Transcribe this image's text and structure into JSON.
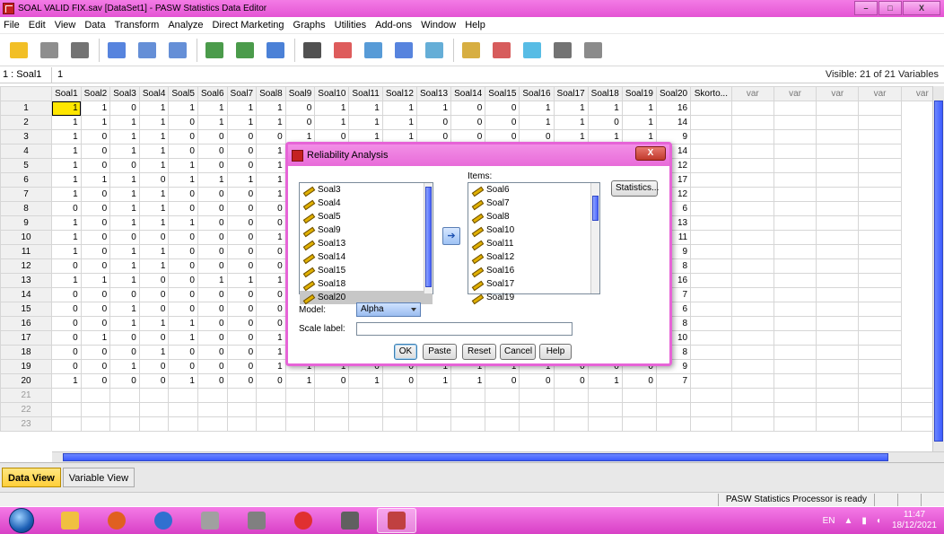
{
  "window": {
    "title": "SOAL VALID FIX.sav [DataSet1] - PASW Statistics Data Editor",
    "min": "–",
    "max": "□",
    "close": "X"
  },
  "menu": [
    "File",
    "Edit",
    "View",
    "Data",
    "Transform",
    "Analyze",
    "Direct Marketing",
    "Graphs",
    "Utilities",
    "Add-ons",
    "Window",
    "Help"
  ],
  "toolbar_icons": [
    "open-icon",
    "save-icon",
    "print-icon",
    "dialog-recall-icon",
    "undo-icon",
    "redo-icon",
    "goto-case-icon",
    "goto-variable-icon",
    "variables-icon",
    "find-icon",
    "insert-cases-icon",
    "insert-variable-icon",
    "split-file-icon",
    "weight-cases-icon",
    "select-cases-icon",
    "value-labels-icon",
    "use-sets-icon",
    "show-all-icon",
    "spelling-icon"
  ],
  "cellbar": {
    "ref": "1 : Soal1",
    "value": "1",
    "visible": "Visible: 21 of 21 Variables"
  },
  "grid": {
    "columns": [
      "Soal1",
      "Soal2",
      "Soal3",
      "Soal4",
      "Soal5",
      "Soal6",
      "Soal7",
      "Soal8",
      "Soal9",
      "Soal10",
      "Soal11",
      "Soal12",
      "Soal13",
      "Soal14",
      "Soal15",
      "Soal16",
      "Soal17",
      "Soal18",
      "Soal19",
      "Soal20",
      "Skorto..."
    ],
    "var_label": "var",
    "rows": [
      [
        "1",
        "1",
        "1",
        "0",
        "1",
        "1",
        "1",
        "1",
        "1",
        "0",
        "1",
        "1",
        "1",
        "1",
        "0",
        "0",
        "1",
        "1",
        "1",
        "1",
        "16"
      ],
      [
        "2",
        "1",
        "1",
        "1",
        "1",
        "0",
        "1",
        "1",
        "1",
        "0",
        "1",
        "1",
        "1",
        "0",
        "0",
        "0",
        "1",
        "1",
        "0",
        "1",
        "14"
      ],
      [
        "3",
        "1",
        "0",
        "1",
        "1",
        "0",
        "0",
        "0",
        "0",
        "1",
        "0",
        "1",
        "1",
        "0",
        "0",
        "0",
        "0",
        "1",
        "1",
        "1",
        "9"
      ],
      [
        "4",
        "1",
        "0",
        "1",
        "1",
        "0",
        "0",
        "0",
        "1",
        "",
        "",
        "",
        "",
        "",
        "",
        "",
        "",
        "",
        "",
        "",
        "14"
      ],
      [
        "5",
        "1",
        "0",
        "0",
        "1",
        "1",
        "0",
        "0",
        "1",
        "",
        "",
        "",
        "",
        "",
        "",
        "",
        "",
        "",
        "",
        "",
        "12"
      ],
      [
        "6",
        "1",
        "1",
        "1",
        "0",
        "1",
        "1",
        "1",
        "1",
        "",
        "",
        "",
        "",
        "",
        "",
        "",
        "",
        "",
        "",
        "",
        "17"
      ],
      [
        "7",
        "1",
        "0",
        "1",
        "1",
        "0",
        "0",
        "0",
        "1",
        "",
        "",
        "",
        "",
        "",
        "",
        "",
        "",
        "",
        "",
        "",
        "12"
      ],
      [
        "8",
        "0",
        "0",
        "1",
        "1",
        "0",
        "0",
        "0",
        "0",
        "",
        "",
        "",
        "",
        "",
        "",
        "",
        "",
        "",
        "",
        "",
        "6"
      ],
      [
        "9",
        "1",
        "0",
        "1",
        "1",
        "1",
        "0",
        "0",
        "0",
        "",
        "",
        "",
        "",
        "",
        "",
        "",
        "",
        "",
        "",
        "",
        "13"
      ],
      [
        "10",
        "1",
        "0",
        "0",
        "0",
        "0",
        "0",
        "0",
        "1",
        "",
        "",
        "",
        "",
        "",
        "",
        "",
        "",
        "",
        "",
        "",
        "11"
      ],
      [
        "11",
        "1",
        "0",
        "1",
        "1",
        "0",
        "0",
        "0",
        "0",
        "",
        "",
        "",
        "",
        "",
        "",
        "",
        "",
        "",
        "",
        "",
        "9"
      ],
      [
        "12",
        "0",
        "0",
        "1",
        "1",
        "0",
        "0",
        "0",
        "0",
        "",
        "",
        "",
        "",
        "",
        "",
        "",
        "",
        "",
        "",
        "",
        "8"
      ],
      [
        "13",
        "1",
        "1",
        "1",
        "0",
        "0",
        "1",
        "1",
        "1",
        "",
        "",
        "",
        "",
        "",
        "",
        "",
        "",
        "",
        "",
        "",
        "16"
      ],
      [
        "14",
        "0",
        "0",
        "0",
        "0",
        "0",
        "0",
        "0",
        "0",
        "",
        "",
        "",
        "",
        "",
        "",
        "",
        "",
        "",
        "",
        "",
        "7"
      ],
      [
        "15",
        "0",
        "0",
        "1",
        "0",
        "0",
        "0",
        "0",
        "0",
        "",
        "",
        "",
        "",
        "",
        "",
        "",
        "",
        "",
        "",
        "",
        "6"
      ],
      [
        "16",
        "0",
        "0",
        "1",
        "1",
        "1",
        "0",
        "0",
        "0",
        "",
        "",
        "",
        "",
        "",
        "",
        "",
        "",
        "",
        "",
        "",
        "8"
      ],
      [
        "17",
        "0",
        "1",
        "0",
        "0",
        "1",
        "0",
        "0",
        "1",
        "",
        "",
        "",
        "",
        "",
        "",
        "",
        "",
        "",
        "",
        "",
        "10"
      ],
      [
        "18",
        "0",
        "0",
        "0",
        "1",
        "0",
        "0",
        "0",
        "1",
        "",
        "",
        "",
        "",
        "",
        "",
        "",
        "",
        "",
        "",
        "",
        "8"
      ],
      [
        "19",
        "0",
        "0",
        "1",
        "0",
        "0",
        "0",
        "0",
        "1",
        "1",
        "1",
        "0",
        "0",
        "1",
        "1",
        "1",
        "1",
        "0",
        "0",
        "0",
        "9"
      ],
      [
        "20",
        "1",
        "0",
        "0",
        "0",
        "1",
        "0",
        "0",
        "0",
        "1",
        "0",
        "1",
        "0",
        "1",
        "1",
        "0",
        "0",
        "0",
        "1",
        "0",
        "7"
      ]
    ],
    "empty_rows": [
      "21",
      "22",
      "23"
    ]
  },
  "tabs": {
    "data_view": "Data View",
    "variable_view": "Variable View"
  },
  "status": {
    "processor": "PASW Statistics Processor is ready"
  },
  "dialog": {
    "title": "Reliability Analysis",
    "close": "X",
    "source_vars": [
      "Soal3",
      "Soal4",
      "Soal5",
      "Soal9",
      "Soal13",
      "Soal14",
      "Soal15",
      "Soal18",
      "Soal20"
    ],
    "items_label": "Items:",
    "items_vars": [
      "Soal6",
      "Soal7",
      "Soal8",
      "Soal10",
      "Soal11",
      "Soal12",
      "Soal16",
      "Soal17",
      "Soal19"
    ],
    "statistics_label": "Statistics...",
    "model_label": "Model:",
    "model_value": "Alpha",
    "scale_label": "Scale label:",
    "buttons": {
      "ok": "OK",
      "paste": "Paste",
      "reset": "Reset",
      "cancel": "Cancel",
      "help": "Help"
    }
  },
  "taskbar": {
    "apps": [
      "explorer-icon",
      "firefox-icon",
      "chrome-icon",
      "calendar-icon",
      "pencil-app-icon",
      "opera-icon",
      "notepad-icon",
      "pasw-icon"
    ],
    "lang": "EN",
    "time": "11:47",
    "date": "18/12/2021"
  },
  "colors": {
    "accent": "#e454d4",
    "active_cell": "#ffe600"
  }
}
